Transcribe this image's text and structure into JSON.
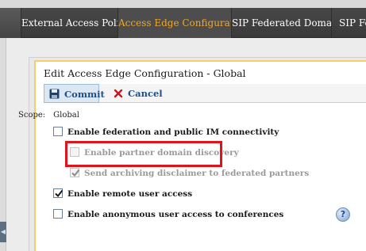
{
  "tabs": [
    {
      "label": "External Access Policy",
      "active": false
    },
    {
      "label": "Access Edge Configuration",
      "active": true
    },
    {
      "label": "SIP Federated Domains",
      "active": false
    },
    {
      "label": "SIP Fede",
      "active": false
    }
  ],
  "dialog": {
    "title": "Edit Access Edge Configuration - Global",
    "toolbar": {
      "commit_label": "Commit",
      "cancel_label": "Cancel"
    },
    "scope": {
      "label": "Scope:",
      "value": "Global"
    },
    "options": {
      "federation": {
        "label": "Enable federation and public IM connectivity",
        "checked": false,
        "enabled": true
      },
      "partner_discovery": {
        "label": "Enable partner domain discovery",
        "checked": false,
        "enabled": false
      },
      "archiving_disclaimer": {
        "label": "Send archiving disclaimer to federated partners",
        "checked": true,
        "enabled": false
      },
      "remote_access": {
        "label": "Enable remote user access",
        "checked": true,
        "enabled": true
      },
      "anonymous_access": {
        "label": "Enable anonymous user access to conferences",
        "checked": false,
        "enabled": true
      }
    }
  },
  "colors": {
    "active_tab": "#f0a62c",
    "highlight": "#e0131b",
    "dialog_border": "#f3cf6a",
    "link_blue": "#1f4f89"
  },
  "icons": {
    "commit": "save-disk-icon",
    "cancel": "x-icon",
    "help": "help-icon",
    "collapse": "triangle-left-icon"
  }
}
